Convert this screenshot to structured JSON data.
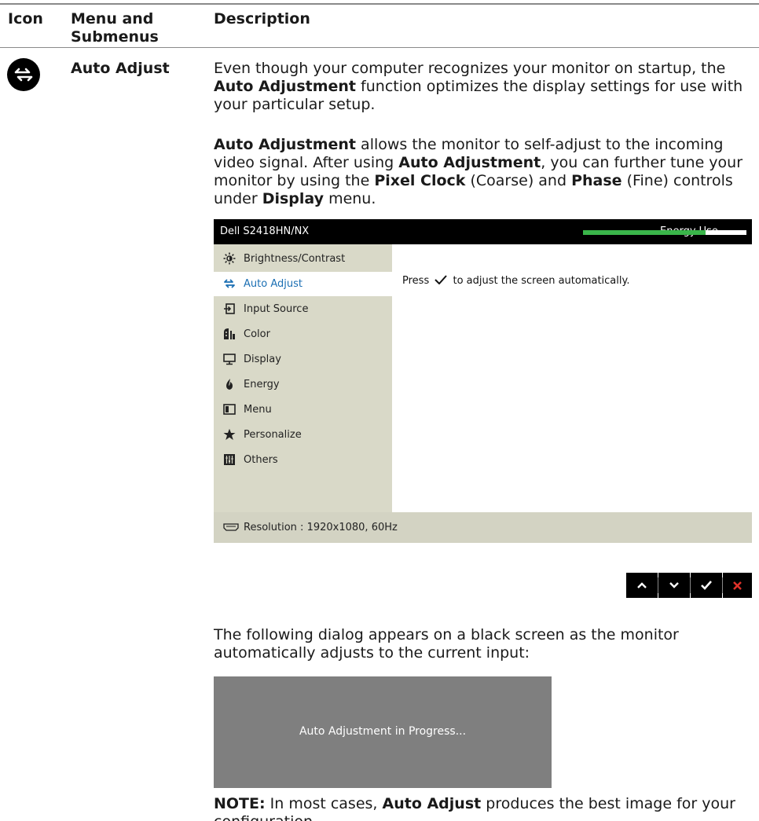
{
  "table_header": {
    "icon": "Icon",
    "menu_line1": "Menu and",
    "menu_line2": "Submenus",
    "description": "Description"
  },
  "row": {
    "icon": "auto-adjust-icon",
    "label": "Auto Adjust"
  },
  "paragraphs": {
    "p1": {
      "a": "Even though your computer recognizes your monitor on startup, the ",
      "b": "Auto Adjustment",
      "c": " function optimizes the display settings for use with your particular setup."
    },
    "p2": {
      "a": "Auto Adjustment",
      "b": " allows the monitor to self-adjust to the incoming video signal. After using ",
      "c": "Auto Adjustment",
      "d": ", you can further tune your monitor by using the ",
      "e": "Pixel Clock",
      "f": " (Coarse) and ",
      "g": "Phase",
      "h": " (Fine) controls under ",
      "i": "Display",
      "j": " menu."
    },
    "p3": "The following dialog appears on a black screen as the monitor automatically adjusts to the current input:",
    "note": {
      "a": "NOTE:",
      "b": " In most cases, ",
      "c": "Auto Adjust",
      "d": " produces the best image for your configuration."
    }
  },
  "osd": {
    "title": "Dell S2418HN/NX",
    "energy_label": "Energy Use",
    "energy_level": 0.75,
    "menu_items": [
      {
        "label": "Brightness/Contrast",
        "icon": "brightness-icon",
        "selected": false
      },
      {
        "label": "Auto Adjust",
        "icon": "auto-adjust-icon",
        "selected": true
      },
      {
        "label": "Input Source",
        "icon": "input-source-icon",
        "selected": false
      },
      {
        "label": "Color",
        "icon": "color-icon",
        "selected": false
      },
      {
        "label": "Display",
        "icon": "display-icon",
        "selected": false
      },
      {
        "label": "Energy",
        "icon": "energy-icon",
        "selected": false
      },
      {
        "label": "Menu",
        "icon": "menu-icon",
        "selected": false
      },
      {
        "label": "Personalize",
        "icon": "star-icon",
        "selected": false
      },
      {
        "label": "Others",
        "icon": "others-icon",
        "selected": false
      }
    ],
    "message_before": "Press",
    "message_after": "to adjust the screen automatically.",
    "footer_resolution": "Resolution : 1920x1080, 60Hz"
  },
  "nav_buttons": [
    "up-icon",
    "down-icon",
    "check-icon",
    "close-icon"
  ],
  "dialog": {
    "text": "Auto Adjustment in Progress..."
  },
  "colors": {
    "osd_header": "#000000",
    "osd_menu_bg": "#d9d9c8",
    "osd_selected_text": "#1b6fb3",
    "energy_green": "#3ab54a",
    "close_red": "#e0322a",
    "dialog_bg": "#7f7f7f"
  }
}
